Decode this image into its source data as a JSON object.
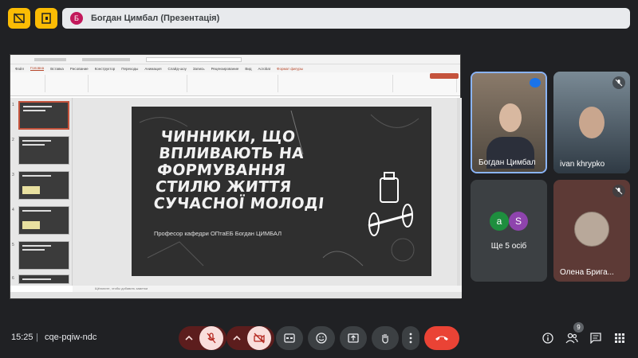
{
  "presenter": {
    "initial": "Б",
    "label": "Богдан Цимбал (Презентація)"
  },
  "powerpoint": {
    "tabs": [
      "Файл",
      "Головна",
      "Вставка",
      "Рисование",
      "Конструктор",
      "Переходы",
      "Анимация",
      "Слайд-шоу",
      "Запись",
      "Рецензирование",
      "Вид",
      "Acrobat",
      "Формат фигуры"
    ],
    "active_tab": "Головна",
    "thumbnails": [
      "1",
      "2",
      "3",
      "4",
      "5",
      "6"
    ],
    "notes_placeholder": "Щёлкните, чтобы добавить заметки"
  },
  "slide": {
    "title": "ЧИННИКИ, ЩО ВПЛИВАЮТЬ НА ФОРМУВАННЯ СТИЛЮ ЖИТТЯ СУЧАСНОЇ МОЛОДІ",
    "subtitle": "Професор кафедри ОПтаЕБ Богдан ЦИМБАЛ"
  },
  "participants": [
    {
      "name": "Богдан Цимбал",
      "muted": false
    },
    {
      "name": "ivan khrypko",
      "muted": true
    },
    {
      "name": "Ще 5 осіб",
      "avatars": [
        "a",
        "S"
      ]
    },
    {
      "name": "Олена Брига...",
      "muted": true
    }
  ],
  "colors": {
    "accent_yellow": "#fbbc04",
    "end_call": "#ea4335",
    "avatar_green": "#1e8e3e",
    "avatar_purple": "#8e44ad"
  },
  "footer": {
    "time": "15:25",
    "separator": "|",
    "meeting_code": "cqe-pqiw-ndc",
    "people_count": "9"
  },
  "controls": {
    "mic_label": "mic-off",
    "cam_label": "camera-off"
  }
}
